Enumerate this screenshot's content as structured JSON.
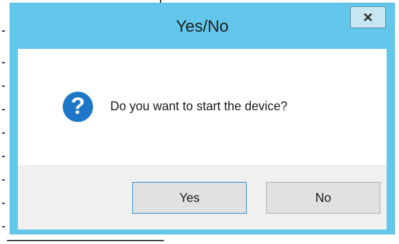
{
  "dialog": {
    "title": "Yes/No",
    "close_label": "x",
    "message": "Do you want to start the device?",
    "icon": "question-icon",
    "icon_glyph": "?",
    "buttons": {
      "yes_label": "Yes",
      "no_label": "No"
    },
    "colors": {
      "titlebar": "#63c7ec",
      "icon": "#1e76c8",
      "button_area": "#f0f0f0",
      "default_button_border": "#2a8ad4"
    }
  }
}
